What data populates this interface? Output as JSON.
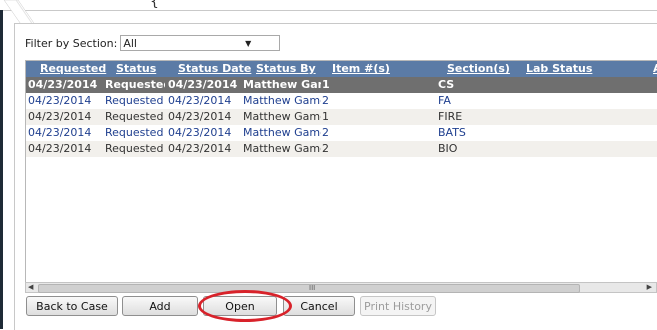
{
  "filter": {
    "label": "Filter by Section:",
    "selected": "All"
  },
  "grid": {
    "columns": [
      "Requested",
      "Status",
      "Status Date",
      "Status By",
      "Item #(s)",
      "Section(s)",
      "Lab Status",
      "A"
    ],
    "rows": [
      {
        "requested": "04/23/2014",
        "status": "Requested",
        "status_date": "04/23/2014",
        "status_by": "Matthew Gamet",
        "items": "1",
        "sections": "CS",
        "lab_status": ""
      },
      {
        "requested": "04/23/2014",
        "status": "Requested",
        "status_date": "04/23/2014",
        "status_by": "Matthew Gametti",
        "items": "2",
        "sections": "FA",
        "lab_status": ""
      },
      {
        "requested": "04/23/2014",
        "status": "Requested",
        "status_date": "04/23/2014",
        "status_by": "Matthew Gametti",
        "items": "1",
        "sections": "FIRE",
        "lab_status": ""
      },
      {
        "requested": "04/23/2014",
        "status": "Requested",
        "status_date": "04/23/2014",
        "status_by": "Matthew Gametti",
        "items": "2",
        "sections": "BATS",
        "lab_status": ""
      },
      {
        "requested": "04/23/2014",
        "status": "Requested",
        "status_date": "04/23/2014",
        "status_by": "Matthew Gametti",
        "items": "2",
        "sections": "BIO",
        "lab_status": ""
      }
    ]
  },
  "scrollbar": {
    "grip": "III"
  },
  "buttons": {
    "back": "Back to Case",
    "add": "Add",
    "open": "Open",
    "cancel": "Cancel",
    "print": "Print History"
  },
  "colors": {
    "header": "#5b7ba6",
    "selected_row": "#6f6f6f",
    "highlight_circle": "#d8222a"
  }
}
